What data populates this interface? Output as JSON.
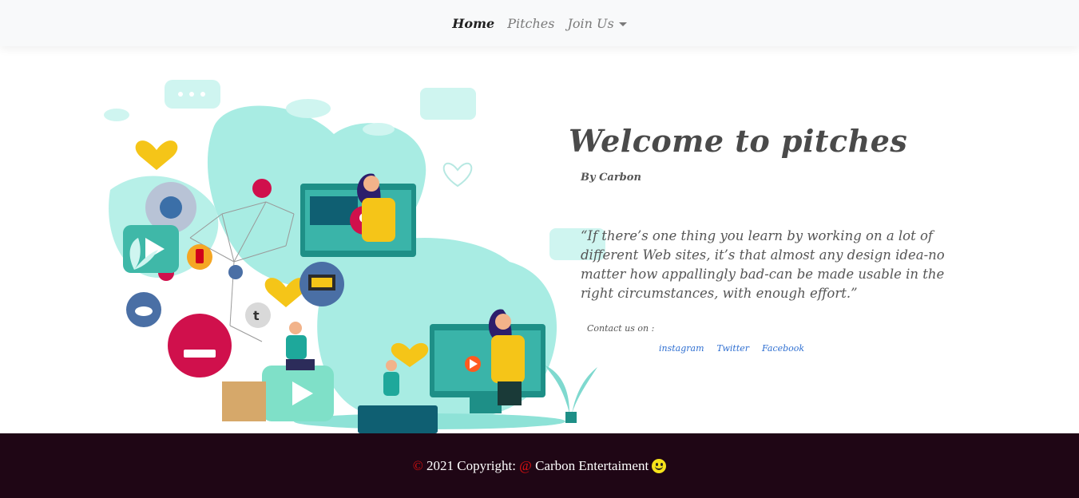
{
  "nav": {
    "items": [
      {
        "label": "Home"
      },
      {
        "label": "Pitches"
      },
      {
        "label": "Join Us"
      }
    ]
  },
  "hero": {
    "title": "Welcome to pitches",
    "byline": "By Carbon",
    "quote": "“If there’s one thing you learn by working on a lot of different Web sites, it’s that almost any design idea-no matter how appallingly bad-can be made usable in the right circumstances, with enough effort.”",
    "contact_label": "Contact us on :",
    "social": [
      "instagram",
      "Twitter",
      "Facebook"
    ]
  },
  "footer": {
    "copyright_symbol": "©",
    "year_text": "2021 Copyright:",
    "at_symbol": "@",
    "company": "Carbon Entertaiment"
  },
  "colors": {
    "navbar_bg": "#f8f9fa",
    "footer_bg": "#1f0615",
    "link_blue": "#2f6fd1",
    "accent_teal": "#a8ece3",
    "accent_yellow": "#f5c518"
  },
  "icons": [
    "dropdown-caret-icon",
    "smiley-emoji-icon"
  ]
}
